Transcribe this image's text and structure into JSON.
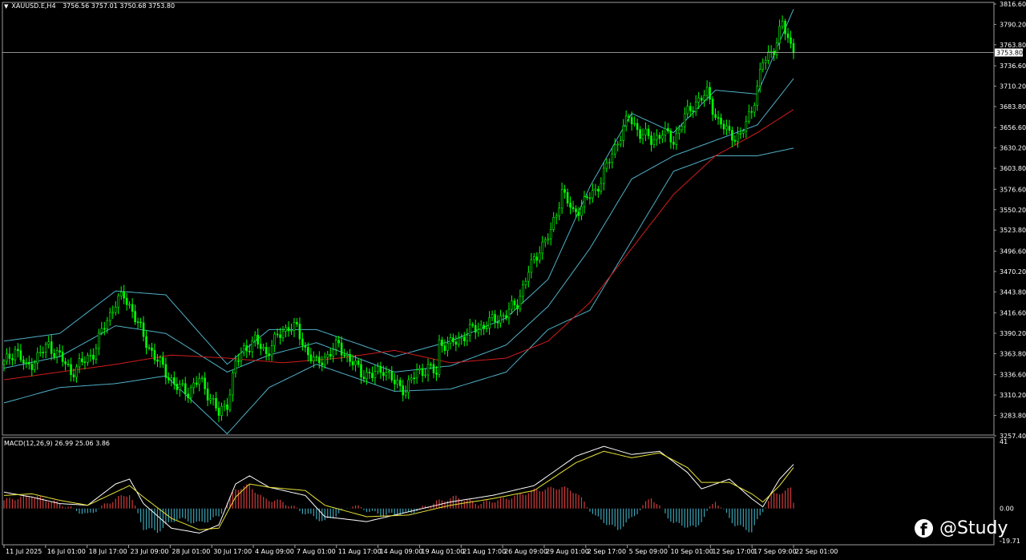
{
  "header": {
    "symbol": "XAUUSD.E,H4",
    "ohlc": "3756.56 3757.01 3750.68 3753.80"
  },
  "macd_header": "MACD(12,26,9) 26.99 25.06 3.86",
  "watermark": "@Study",
  "watermark_icon": "facebook-icon",
  "colors": {
    "background": "#000000",
    "candle": "#00ff00",
    "bands": "#4fb0c6",
    "ma": "#d01c1c",
    "macd_hist_pos": "#d23c3c",
    "macd_hist_neg": "#3aa3b6",
    "macd_line": "#ffffff",
    "signal_line": "#e8e337",
    "price_line": "#c0c0c0",
    "price_box": "#ffffff"
  },
  "chart_data": [
    {
      "type": "candlestick",
      "title": "XAUUSD.E,H4",
      "ylim": [
        3257.4,
        3816.6
      ],
      "price_ticks": [
        "3816.60",
        "3790.20",
        "3763.80",
        "3736.60",
        "3710.20",
        "3683.80",
        "3656.60",
        "3630.20",
        "3603.80",
        "3576.60",
        "3550.20",
        "3523.80",
        "3496.60",
        "3470.20",
        "3443.80",
        "3416.60",
        "3390.20",
        "3363.80",
        "3336.60",
        "3310.20",
        "3283.80",
        "3257.40"
      ],
      "current_price": "3753.80",
      "x_labels": [
        "11 Jul 2025",
        "16 Jul 01:00",
        "18 Jul 17:00",
        "23 Jul 09:00",
        "28 Jul 01:00",
        "30 Jul 17:00",
        "4 Aug 09:00",
        "7 Aug 01:00",
        "11 Aug 17:00",
        "14 Aug 09:00",
        "19 Aug 01:00",
        "21 Aug 17:00",
        "26 Aug 09:00",
        "29 Aug 01:00",
        "2 Sep 17:00",
        "5 Sep 09:00",
        "10 Sep 01:00",
        "12 Sep 17:00",
        "17 Sep 09:00",
        "22 Sep 01:00"
      ],
      "close_path": [
        [
          0,
          3350
        ],
        [
          4,
          3370
        ],
        [
          8,
          3345
        ],
        [
          12,
          3360
        ],
        [
          16,
          3375
        ],
        [
          20,
          3360
        ],
        [
          24,
          3340
        ],
        [
          28,
          3352
        ],
        [
          32,
          3365
        ],
        [
          36,
          3400
        ],
        [
          40,
          3430
        ],
        [
          43,
          3438
        ],
        [
          46,
          3420
        ],
        [
          50,
          3385
        ],
        [
          54,
          3360
        ],
        [
          58,
          3340
        ],
        [
          62,
          3320
        ],
        [
          66,
          3315
        ],
        [
          70,
          3330
        ],
        [
          74,
          3308
        ],
        [
          77,
          3285
        ],
        [
          80,
          3300
        ],
        [
          83,
          3350
        ],
        [
          86,
          3370
        ],
        [
          90,
          3380
        ],
        [
          94,
          3365
        ],
        [
          98,
          3385
        ],
        [
          102,
          3400
        ],
        [
          105,
          3395
        ],
        [
          108,
          3370
        ],
        [
          112,
          3350
        ],
        [
          116,
          3362
        ],
        [
          120,
          3375
        ],
        [
          124,
          3355
        ],
        [
          128,
          3340
        ],
        [
          132,
          3335
        ],
        [
          136,
          3345
        ],
        [
          140,
          3325
        ],
        [
          144,
          3318
        ],
        [
          148,
          3340
        ],
        [
          152,
          3345
        ],
        [
          155,
          3338
        ],
        [
          156,
          3378
        ],
        [
          160,
          3375
        ],
        [
          164,
          3385
        ],
        [
          168,
          3395
        ],
        [
          172,
          3400
        ],
        [
          176,
          3408
        ],
        [
          180,
          3415
        ],
        [
          184,
          3430
        ],
        [
          188,
          3470
        ],
        [
          192,
          3500
        ],
        [
          196,
          3520
        ],
        [
          200,
          3575
        ],
        [
          204,
          3545
        ],
        [
          208,
          3560
        ],
        [
          212,
          3575
        ],
        [
          216,
          3605
        ],
        [
          220,
          3640
        ],
        [
          224,
          3670
        ],
        [
          228,
          3650
        ],
        [
          232,
          3640
        ],
        [
          236,
          3650
        ],
        [
          240,
          3640
        ],
        [
          244,
          3670
        ],
        [
          248,
          3690
        ],
        [
          252,
          3700
        ],
        [
          256,
          3665
        ],
        [
          260,
          3648
        ],
        [
          264,
          3645
        ],
        [
          268,
          3680
        ],
        [
          272,
          3740
        ],
        [
          276,
          3760
        ],
        [
          279,
          3790
        ],
        [
          283,
          3753.8
        ]
      ],
      "ma": [
        [
          0,
          3330
        ],
        [
          20,
          3340
        ],
        [
          40,
          3350
        ],
        [
          60,
          3362
        ],
        [
          80,
          3358
        ],
        [
          100,
          3352
        ],
        [
          120,
          3358
        ],
        [
          140,
          3368
        ],
        [
          160,
          3352
        ],
        [
          180,
          3358
        ],
        [
          195,
          3380
        ],
        [
          210,
          3430
        ],
        [
          225,
          3500
        ],
        [
          240,
          3570
        ],
        [
          255,
          3620
        ],
        [
          270,
          3650
        ],
        [
          283,
          3680
        ]
      ],
      "bb_upper": [
        [
          0,
          3380
        ],
        [
          20,
          3390
        ],
        [
          40,
          3445
        ],
        [
          58,
          3440
        ],
        [
          80,
          3350
        ],
        [
          95,
          3395
        ],
        [
          112,
          3395
        ],
        [
          140,
          3360
        ],
        [
          160,
          3380
        ],
        [
          180,
          3410
        ],
        [
          195,
          3460
        ],
        [
          210,
          3580
        ],
        [
          225,
          3675
        ],
        [
          240,
          3650
        ],
        [
          255,
          3705
        ],
        [
          270,
          3700
        ],
        [
          283,
          3810
        ]
      ],
      "bb_mid": [
        [
          0,
          3345
        ],
        [
          20,
          3360
        ],
        [
          40,
          3400
        ],
        [
          58,
          3390
        ],
        [
          80,
          3340
        ],
        [
          95,
          3362
        ],
        [
          112,
          3378
        ],
        [
          140,
          3340
        ],
        [
          160,
          3348
        ],
        [
          180,
          3375
        ],
        [
          195,
          3425
        ],
        [
          210,
          3500
        ],
        [
          225,
          3590
        ],
        [
          240,
          3620
        ],
        [
          255,
          3640
        ],
        [
          270,
          3660
        ],
        [
          283,
          3720
        ]
      ],
      "bb_lower": [
        [
          0,
          3300
        ],
        [
          20,
          3320
        ],
        [
          40,
          3325
        ],
        [
          58,
          3335
        ],
        [
          80,
          3260
        ],
        [
          95,
          3320
        ],
        [
          112,
          3350
        ],
        [
          140,
          3315
        ],
        [
          160,
          3318
        ],
        [
          180,
          3340
        ],
        [
          195,
          3395
        ],
        [
          210,
          3420
        ],
        [
          225,
          3510
        ],
        [
          240,
          3600
        ],
        [
          255,
          3620
        ],
        [
          270,
          3620
        ],
        [
          283,
          3630
        ]
      ]
    },
    {
      "type": "macd",
      "title": "MACD(12,26,9)",
      "ylim": [
        -19.71,
        41
      ],
      "y_ticks": [
        "41",
        "0.00",
        "-19.71"
      ],
      "histogram": [
        [
          0,
          5
        ],
        [
          10,
          8
        ],
        [
          20,
          3
        ],
        [
          30,
          -4
        ],
        [
          40,
          6
        ],
        [
          45,
          9
        ],
        [
          50,
          -12
        ],
        [
          55,
          -14
        ],
        [
          62,
          -6
        ],
        [
          70,
          -9
        ],
        [
          77,
          -5
        ],
        [
          83,
          12
        ],
        [
          88,
          14
        ],
        [
          93,
          6
        ],
        [
          100,
          4
        ],
        [
          108,
          -3
        ],
        [
          115,
          -8
        ],
        [
          125,
          2
        ],
        [
          135,
          -4
        ],
        [
          145,
          -3
        ],
        [
          155,
          4
        ],
        [
          162,
          7
        ],
        [
          170,
          3
        ],
        [
          180,
          6
        ],
        [
          190,
          11
        ],
        [
          200,
          13
        ],
        [
          205,
          10
        ],
        [
          212,
          -5
        ],
        [
          220,
          -13
        ],
        [
          225,
          -6
        ],
        [
          232,
          7
        ],
        [
          240,
          -9
        ],
        [
          248,
          -12
        ],
        [
          255,
          5
        ],
        [
          262,
          -10
        ],
        [
          268,
          -14
        ],
        [
          275,
          8
        ],
        [
          282,
          12
        ],
        [
          283,
          3.86
        ]
      ],
      "macd_line": [
        [
          0,
          10
        ],
        [
          10,
          7
        ],
        [
          20,
          3
        ],
        [
          30,
          2
        ],
        [
          40,
          15
        ],
        [
          45,
          18
        ],
        [
          50,
          3
        ],
        [
          60,
          -12
        ],
        [
          70,
          -15
        ],
        [
          77,
          -10
        ],
        [
          83,
          15
        ],
        [
          88,
          20
        ],
        [
          95,
          13
        ],
        [
          108,
          8
        ],
        [
          115,
          -5
        ],
        [
          130,
          -8
        ],
        [
          145,
          -2
        ],
        [
          160,
          4
        ],
        [
          175,
          8
        ],
        [
          190,
          14
        ],
        [
          205,
          32
        ],
        [
          215,
          38
        ],
        [
          225,
          33
        ],
        [
          235,
          35
        ],
        [
          245,
          22
        ],
        [
          250,
          12
        ],
        [
          260,
          18
        ],
        [
          268,
          6
        ],
        [
          272,
          1
        ],
        [
          278,
          18
        ],
        [
          283,
          26.99
        ]
      ],
      "signal_line": [
        [
          0,
          8
        ],
        [
          10,
          9
        ],
        [
          20,
          5
        ],
        [
          30,
          2
        ],
        [
          40,
          10
        ],
        [
          45,
          14
        ],
        [
          50,
          7
        ],
        [
          60,
          -6
        ],
        [
          70,
          -13
        ],
        [
          77,
          -12
        ],
        [
          83,
          7
        ],
        [
          88,
          15
        ],
        [
          95,
          13
        ],
        [
          108,
          11
        ],
        [
          115,
          2
        ],
        [
          130,
          -5
        ],
        [
          145,
          -4
        ],
        [
          160,
          2
        ],
        [
          175,
          6
        ],
        [
          190,
          11
        ],
        [
          205,
          28
        ],
        [
          215,
          35
        ],
        [
          225,
          31
        ],
        [
          235,
          34
        ],
        [
          245,
          25
        ],
        [
          250,
          16
        ],
        [
          260,
          16
        ],
        [
          268,
          9
        ],
        [
          272,
          4
        ],
        [
          278,
          14
        ],
        [
          283,
          25.06
        ]
      ]
    }
  ]
}
